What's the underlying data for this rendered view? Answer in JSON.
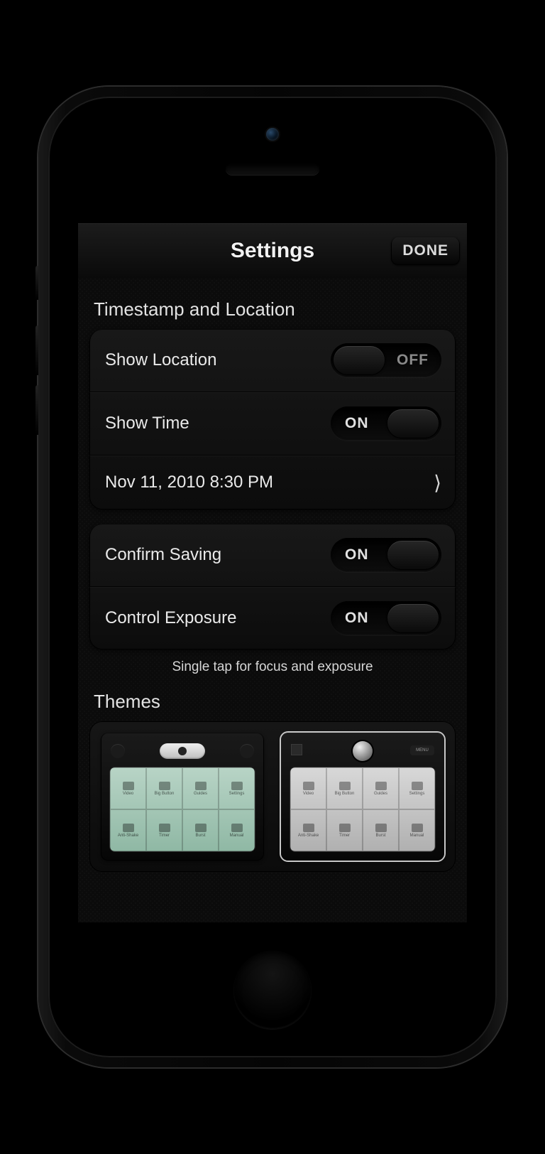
{
  "nav": {
    "title": "Settings",
    "done": "DONE"
  },
  "section1": {
    "title": "Timestamp and Location",
    "showLocation": {
      "label": "Show Location",
      "state": "OFF",
      "on": false
    },
    "showTime": {
      "label": "Show Time",
      "state": "ON",
      "on": true
    },
    "dateRow": {
      "label": "Nov 11, 2010 8:30 PM"
    }
  },
  "section2": {
    "confirmSaving": {
      "label": "Confirm Saving",
      "state": "ON",
      "on": true
    },
    "controlExposure": {
      "label": "Control Exposure",
      "state": "ON",
      "on": true
    },
    "helper": "Single tap for focus and exposure"
  },
  "themes": {
    "title": "Themes",
    "menuChip": "MENU",
    "cells": [
      "Video",
      "Big Button",
      "Guides",
      "Settings",
      "Anti-Shake",
      "Timer",
      "Burst",
      "Manual"
    ]
  }
}
